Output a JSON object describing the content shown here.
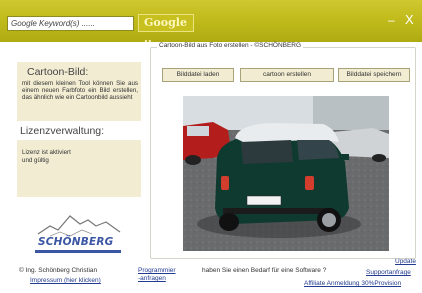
{
  "topbar": {
    "search_placeholder": "Google Keyword(s) ......",
    "search_button": "Google ..",
    "minimize": "–",
    "close": "X"
  },
  "sidebar": {
    "info_title": "Cartoon-Bild:",
    "info_text": "mit diesem kleinen Tool können Sie aus einem neuen Farbfoto ein Bild erstellen, das ähnlich wie ein Cartoonbild aussieht",
    "license_title": "Lizenzverwaltung:",
    "license_text_line1": "Lizenz ist aktiviert",
    "license_text_line2": "und gültig",
    "logo_text": "SCHÖNBERG"
  },
  "main": {
    "group_title": "Cartoon-Bild aus Foto erstellen - ©SCHÖNBERG",
    "buttons": {
      "load": "Bilddatei laden",
      "convert": "cartoon erstellen",
      "save": "Bilddatei speichern"
    }
  },
  "footer": {
    "copyright": "© Ing. Schönberg Christian",
    "imprint": "Impressum (hier klicken)",
    "programming_line1": "Programmier",
    "programming_line2": "-anfragen",
    "question": "haben Sie einen Bedarf für eine Software ?",
    "update": "Update",
    "support": "Supportanfrage",
    "affiliate": "Affiliate Anmeldung 30%Provision"
  },
  "colors": {
    "topbar": "#c2bb1c",
    "panel": "#f1ecd2",
    "logo_blue": "#3b56a3",
    "link": "#223a8f"
  }
}
